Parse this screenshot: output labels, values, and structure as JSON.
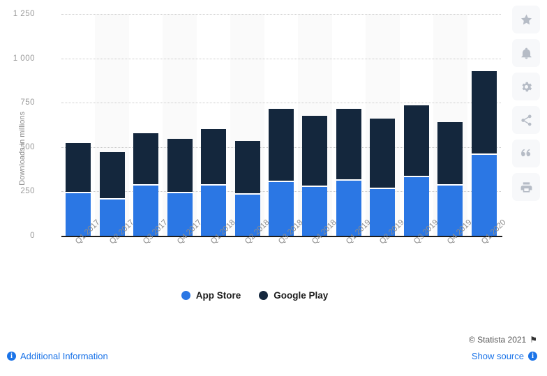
{
  "chart_data": {
    "type": "bar",
    "stacked": true,
    "title": "",
    "xlabel": "",
    "ylabel": "Downloads in millions",
    "ylim": [
      0,
      1250
    ],
    "yticks": [
      0,
      250,
      500,
      750,
      1000,
      1250
    ],
    "ytick_labels": [
      "0",
      "250",
      "500",
      "750",
      "1 000",
      "1 250"
    ],
    "grid": true,
    "legend_position": "bottom",
    "categories": [
      "Q1 2017",
      "Q2 2017",
      "Q3 2017",
      "Q4 2017",
      "Q1 2018",
      "Q2 2018",
      "Q3 2018",
      "Q4 2018",
      "Q1 2019",
      "Q2 2019",
      "Q3 2019",
      "Q4 2019",
      "Q1 2020"
    ],
    "series": [
      {
        "name": "App Store",
        "color": "#2b77e4",
        "values": [
          248,
          214,
          289,
          248,
          289,
          240,
          310,
          285,
          320,
          270,
          339,
          289,
          464
        ]
      },
      {
        "name": "Google Play",
        "color": "#14273d",
        "values": [
          273,
          257,
          287,
          297,
          314,
          296,
          404,
          392,
          394,
          389,
          396,
          351,
          464
        ]
      }
    ],
    "totals": [
      521,
      471,
      576,
      545,
      603,
      536,
      714,
      677,
      714,
      659,
      735,
      640,
      928
    ]
  },
  "legend": {
    "items": [
      {
        "label": "App Store",
        "color": "#2b77e4"
      },
      {
        "label": "Google Play",
        "color": "#14273d"
      }
    ]
  },
  "icon_rail": {
    "items": [
      {
        "name": "star-icon",
        "title": "Favorite"
      },
      {
        "name": "bell-icon",
        "title": "Notifications"
      },
      {
        "name": "gear-icon",
        "title": "Settings"
      },
      {
        "name": "share-icon",
        "title": "Share"
      },
      {
        "name": "quote-icon",
        "title": "Cite"
      },
      {
        "name": "print-icon",
        "title": "Print"
      }
    ]
  },
  "footer": {
    "copyright": "© Statista 2021",
    "flag_glyph": "⚑",
    "additional_information": "Additional Information",
    "show_source": "Show source",
    "info_glyph": "i"
  }
}
